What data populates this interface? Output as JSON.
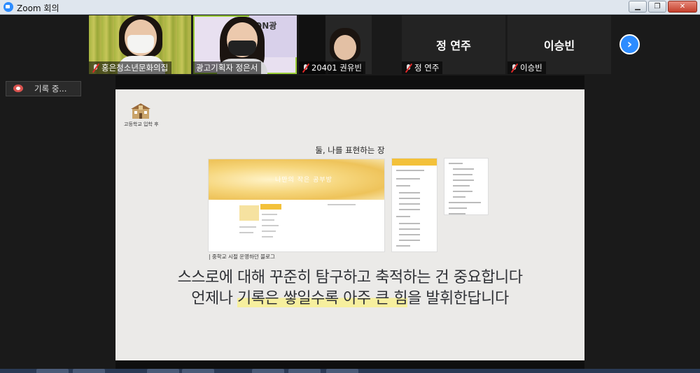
{
  "window": {
    "title": "Zoom 회의",
    "controls": [
      "minimize",
      "restore",
      "close"
    ]
  },
  "participants": [
    {
      "name": "홍은청소년문화의집",
      "video": true,
      "muted": true
    },
    {
      "name": "광고기획자 정은서",
      "video": true,
      "muted": true,
      "active_speaker": true
    },
    {
      "name": "20401 권유빈",
      "video": true,
      "muted": true
    },
    {
      "name": "정 연주",
      "video": false,
      "muted": true,
      "display_name": "정 연주"
    },
    {
      "name": "이승빈",
      "video": false,
      "muted": true,
      "display_name": "이승빈"
    }
  ],
  "next_page_icon": "chevron-right-icon",
  "recording": {
    "label": "기록 중..."
  },
  "slide": {
    "school_logo_text": "고등학교 입학 후",
    "heading": "둘, 나를 표현하는 장",
    "blog_banner_text": "나만의 작은 공부방",
    "caption": "| 중학교 시절 운영하던 블로그",
    "line1": "스스로에 대해 꾸준히 탐구하고 축적하는 건 중요합니다",
    "line2_prefix": "언제나 ",
    "line2_highlight": "기록은 쌓일수록 아주 큰 힘",
    "line2_suffix": "을 발휘한답니다",
    "highlight_color": "#f6ef9e"
  },
  "colors": {
    "zoom_blue": "#2d8cff",
    "mute_red": "#e02828",
    "background": "#1a1a1a"
  }
}
